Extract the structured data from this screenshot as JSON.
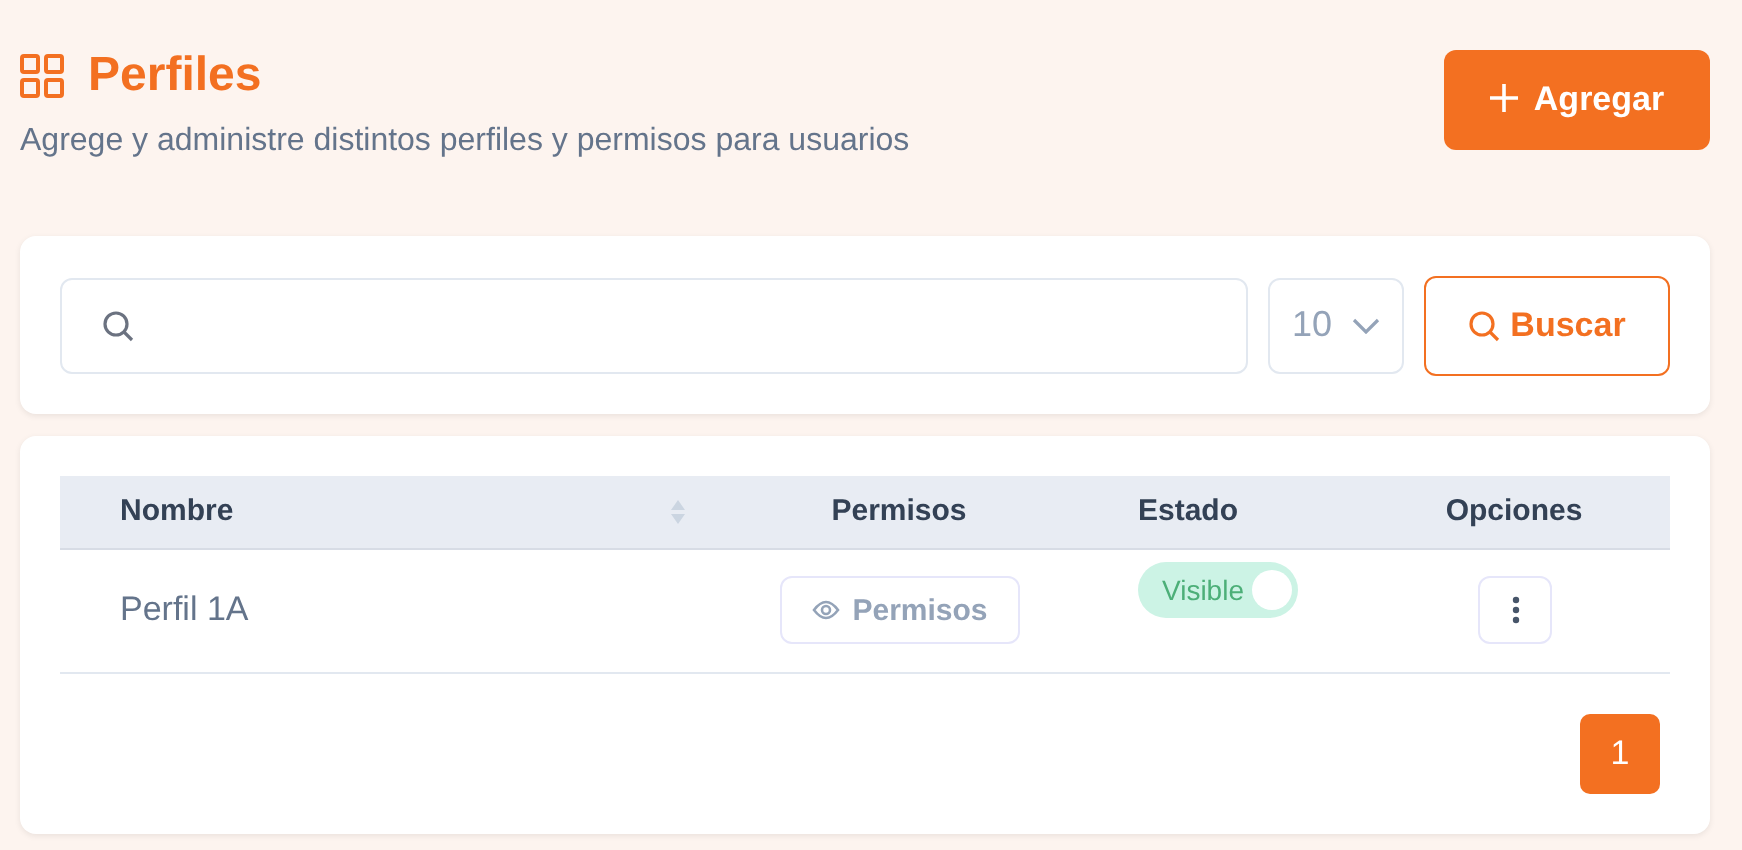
{
  "header": {
    "title": "Perfiles",
    "subtitle": "Agrege y administre distintos perfiles y permisos para usuarios",
    "add_button": "Agregar"
  },
  "search": {
    "per_page": "10",
    "button": "Buscar"
  },
  "table": {
    "columns": [
      {
        "label": "Nombre",
        "sortable": true
      },
      {
        "label": "Permisos",
        "sortable": false
      },
      {
        "label": "Estado",
        "sortable": false
      },
      {
        "label": "Opciones",
        "sortable": false
      }
    ],
    "rows": [
      {
        "name": "Perfil 1A",
        "permissions_button": "Permisos",
        "status": {
          "label": "Visible",
          "on": true
        }
      }
    ]
  },
  "pagination": [
    {
      "label": "1",
      "selected": true
    }
  ]
}
